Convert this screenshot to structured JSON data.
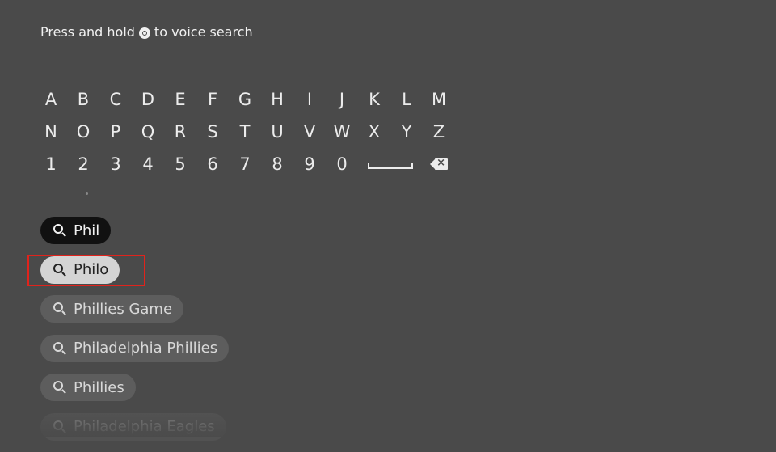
{
  "hint": {
    "before": "Press and hold",
    "icon": "microphone-button-icon",
    "after": "to voice search"
  },
  "keyboard": {
    "row1": [
      "A",
      "B",
      "C",
      "D",
      "E",
      "F",
      "G",
      "H",
      "I",
      "J",
      "K",
      "L",
      "M"
    ],
    "row2": [
      "N",
      "O",
      "P",
      "Q",
      "R",
      "S",
      "T",
      "U",
      "V",
      "W",
      "X",
      "Y",
      "Z"
    ],
    "row3": [
      "1",
      "2",
      "3",
      "4",
      "5",
      "6",
      "7",
      "8",
      "9",
      "0"
    ],
    "space_icon": "space-icon",
    "backspace_icon": "backspace-icon"
  },
  "search": {
    "query": "Phil",
    "suggestions": [
      "Philo",
      "Phillies Game",
      "Philadelphia Phillies",
      "Phillies",
      "Philadelphia Eagles"
    ],
    "focused_index": 0
  },
  "colors": {
    "background": "#4a4a4a",
    "highlight": "#e0231c",
    "focused_chip": "#d4d4d4",
    "query_chip": "#111111"
  }
}
